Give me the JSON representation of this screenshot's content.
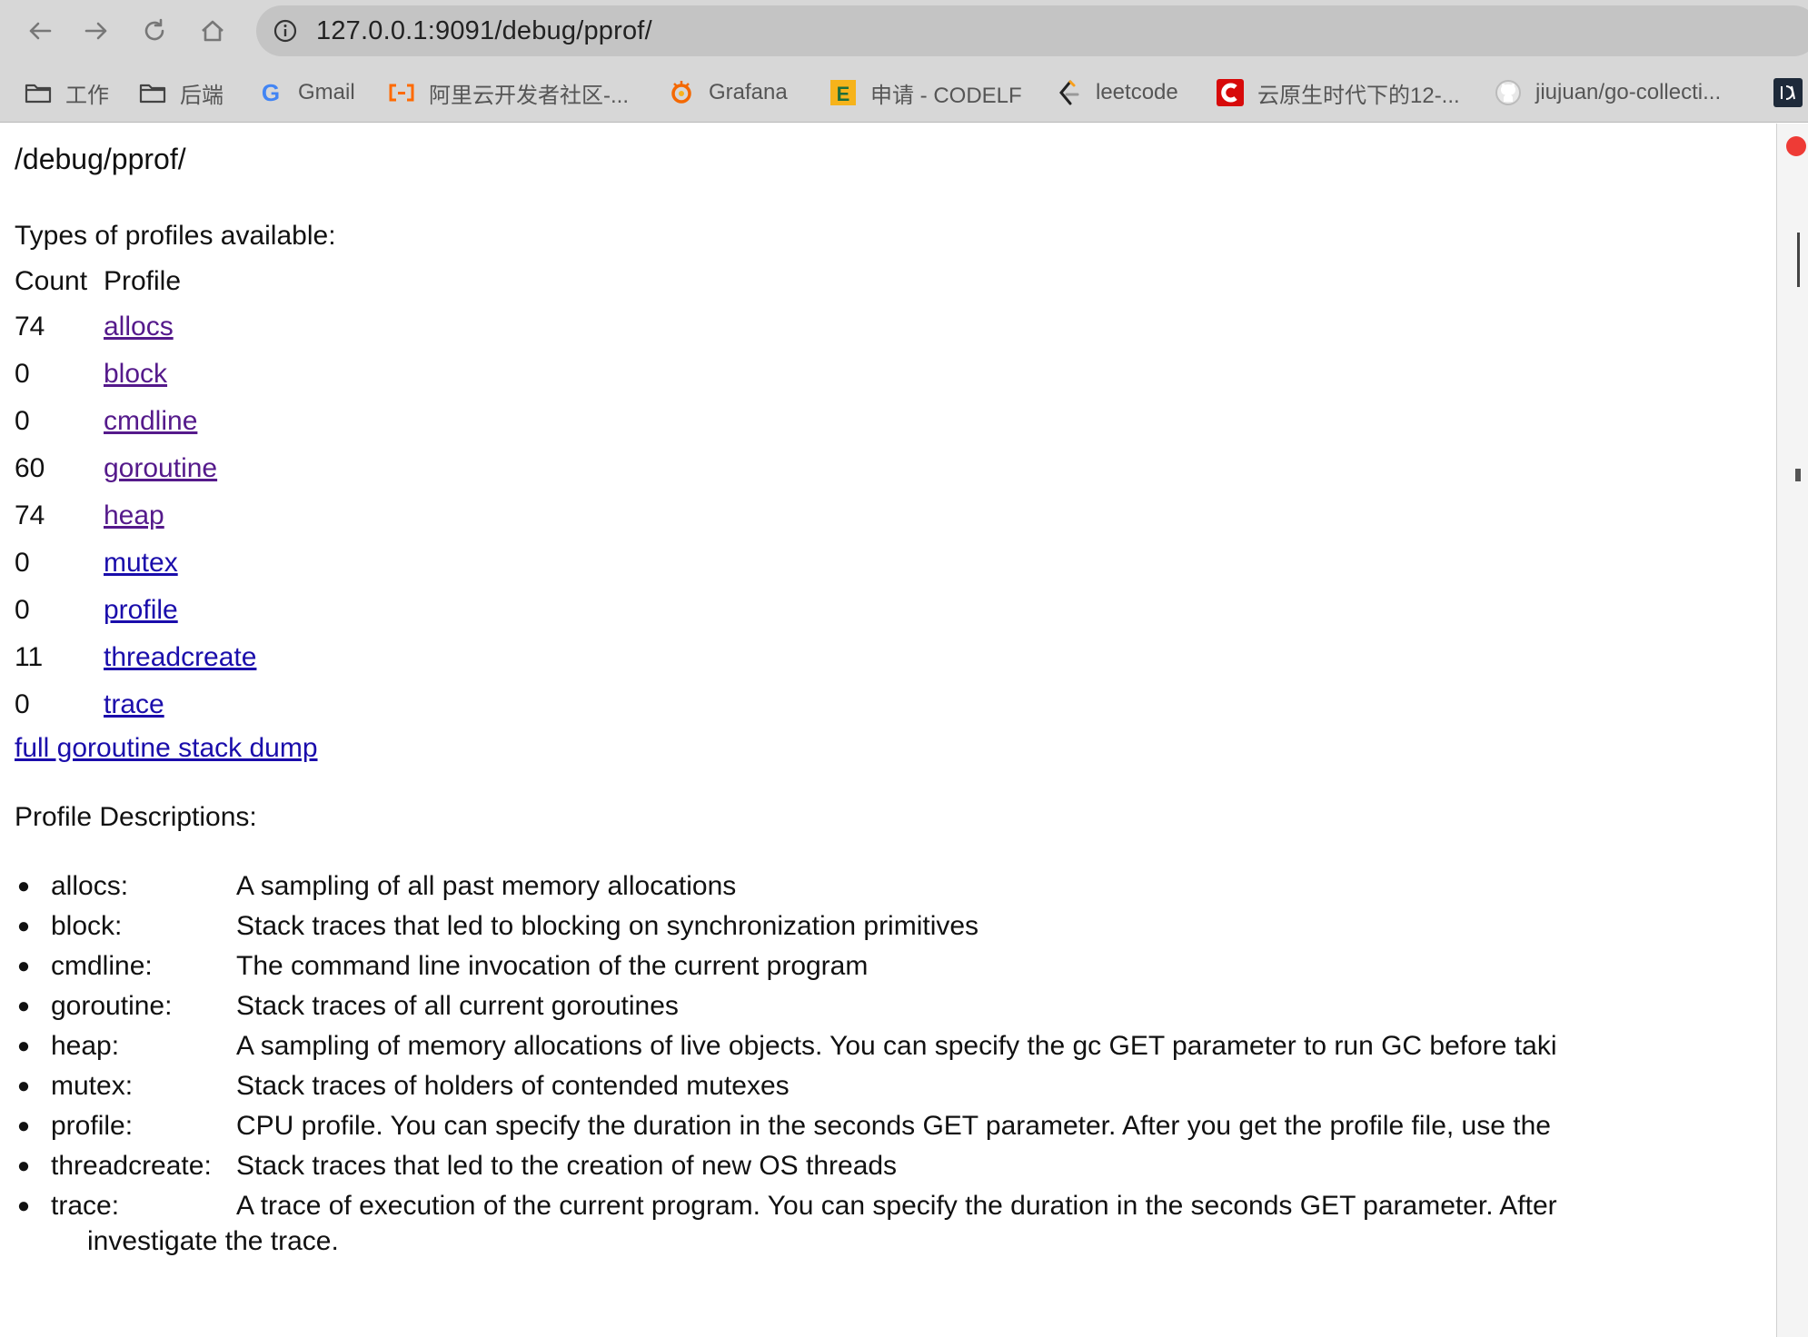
{
  "browser": {
    "url": "127.0.0.1:9091/debug/pprof/",
    "bookmarks": [
      {
        "label": "工作",
        "icon": "folder-icon"
      },
      {
        "label": "后端",
        "icon": "folder-icon"
      },
      {
        "label": "Gmail",
        "icon": "google-icon"
      },
      {
        "label": "阿里云开发者社区-...",
        "icon": "aliyun-icon"
      },
      {
        "label": "Grafana",
        "icon": "grafana-icon"
      },
      {
        "label": "申请 - CODELF",
        "icon": "codelf-icon"
      },
      {
        "label": "leetcode",
        "icon": "leetcode-icon"
      },
      {
        "label": "云原生时代下的12-...",
        "icon": "csdn-icon"
      },
      {
        "label": "jiujuan/go-collecti...",
        "icon": "github-icon"
      }
    ]
  },
  "page": {
    "heading": "/debug/pprof/",
    "types_heading": "Types of profiles available:",
    "table": {
      "headers": [
        "Count",
        "Profile"
      ],
      "rows": [
        {
          "count": "74",
          "profile": "allocs"
        },
        {
          "count": "0",
          "profile": "block"
        },
        {
          "count": "0",
          "profile": "cmdline"
        },
        {
          "count": "60",
          "profile": "goroutine"
        },
        {
          "count": "74",
          "profile": "heap"
        },
        {
          "count": "0",
          "profile": "mutex"
        },
        {
          "count": "0",
          "profile": "profile"
        },
        {
          "count": "11",
          "profile": "threadcreate"
        },
        {
          "count": "0",
          "profile": "trace"
        }
      ]
    },
    "full_dump_link": "full goroutine stack dump",
    "descriptions_heading": "Profile Descriptions:",
    "descriptions": [
      {
        "name": "allocs:",
        "text": "A sampling of all past memory allocations"
      },
      {
        "name": "block:",
        "text": "Stack traces that led to blocking on synchronization primitives"
      },
      {
        "name": "cmdline:",
        "text": "The command line invocation of the current program"
      },
      {
        "name": "goroutine:",
        "text": "Stack traces of all current goroutines"
      },
      {
        "name": "heap:",
        "text": "A sampling of memory allocations of live objects. You can specify the gc GET parameter to run GC before taki"
      },
      {
        "name": "mutex:",
        "text": "Stack traces of holders of contended mutexes"
      },
      {
        "name": "profile:",
        "text": "CPU profile. You can specify the duration in the seconds GET parameter. After you get the profile file, use the"
      },
      {
        "name": "threadcreate:",
        "text": "Stack traces that led to the creation of new OS threads"
      },
      {
        "name": "trace:",
        "text": "A trace of execution of the current program. You can specify the duration in the seconds GET parameter. After"
      }
    ],
    "trace_continuation": "investigate the trace."
  }
}
